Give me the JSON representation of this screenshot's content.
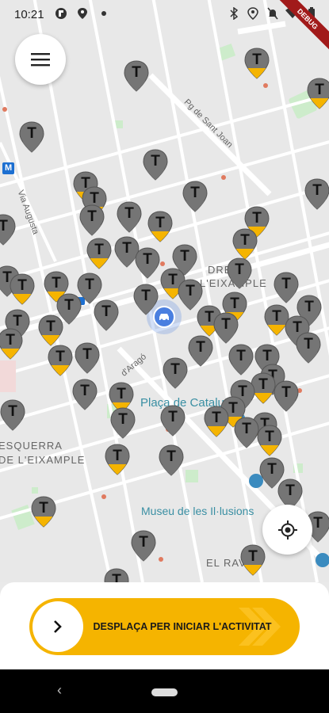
{
  "status_bar": {
    "time": "10:21",
    "icons_left": [
      "flipboard-icon",
      "location-pin-icon",
      "dot-icon"
    ],
    "icons_right": [
      "bluetooth-icon",
      "location-icon",
      "mute-icon",
      "wifi-icon",
      "battery-icon"
    ],
    "debug_label": "DEBUG"
  },
  "map": {
    "labels": {
      "pg_sant_joan": "Pg de Sant Joan",
      "via_augusta": "Via Augusta",
      "dreta": "DRETA",
      "eixample_right": "L'EIXAMPLE",
      "aragon": "d'Aragó",
      "placa": "Plaça de Catalunya",
      "esquerra": "ESQUERRA",
      "eixample_left": "DE L'EIXAMPLE",
      "museu": "Museu de les Il·lusions",
      "raval": "EL RAVAL",
      "metro": "M"
    },
    "taxi_marker_letter": "T",
    "colors": {
      "marker": "#757575",
      "marker_available": "#f5b400",
      "current_location": "#4a7fe0"
    }
  },
  "controls": {
    "menu_icon": "hamburger-menu-icon",
    "my_location_icon": "crosshair-location-icon"
  },
  "bottom_panel": {
    "slider_label": "DESPLAÇA PER INICIAR L'ACTIVITAT",
    "slider_color": "#f5b400"
  },
  "navigation_bar": {
    "back_icon": "back-chevron-icon",
    "home_icon": "home-pill-icon"
  }
}
